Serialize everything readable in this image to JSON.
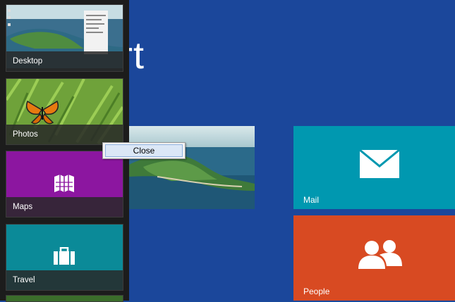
{
  "start": {
    "title": "rt",
    "tiles": {
      "mail": {
        "label": "Mail",
        "icon": "mail-icon"
      },
      "people": {
        "label": "People",
        "icon": "people-icon"
      },
      "desktop": {
        "icon": "desktop-landscape-image"
      }
    }
  },
  "switcher": {
    "items": [
      {
        "label": "Desktop",
        "icon": "desktop-thumbnail"
      },
      {
        "label": "Photos",
        "icon": "butterfly-photo-thumbnail"
      },
      {
        "label": "Maps",
        "icon": "maps-icon"
      },
      {
        "label": "Travel",
        "icon": "suitcase-icon"
      }
    ]
  },
  "context_menu": {
    "close_label": "Close"
  },
  "colors": {
    "start_bg": "#1b479b",
    "mail_tile": "#0098b0",
    "people_tile": "#d84a22",
    "maps_tile": "#8c16a0",
    "travel_tile": "#0b8a98"
  }
}
